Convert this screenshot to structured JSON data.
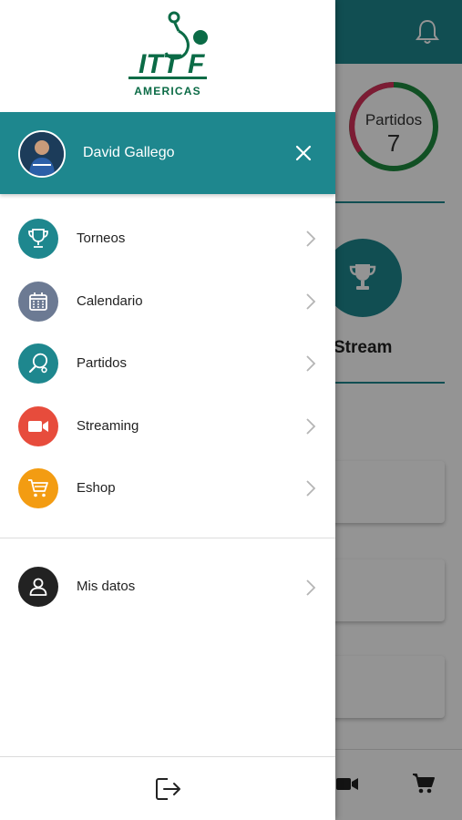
{
  "background": {
    "ring_label": "Partidos",
    "ring_value": "7",
    "stream_label": "Stream",
    "icons": [
      "bell-icon",
      "trophy-icon",
      "video-icon",
      "cart-icon"
    ],
    "colors": {
      "teal": "#1e878e",
      "ring_red": "#d6315b",
      "ring_green": "#1e8a3e"
    }
  },
  "drawer": {
    "logo": {
      "brand": "ITTF",
      "subtitle": "AMERICAS",
      "color": "#0b6b46"
    },
    "user": {
      "name": "David Gallego",
      "close_icon": "close-icon"
    },
    "menu": [
      {
        "label": "Torneos",
        "icon": "trophy-icon",
        "color": "#1e878e"
      },
      {
        "label": "Calendario",
        "icon": "calendar-icon",
        "color": "#6c7a93"
      },
      {
        "label": "Partidos",
        "icon": "paddle-icon",
        "color": "#1e878e"
      },
      {
        "label": "Streaming",
        "icon": "video-icon",
        "color": "#e74c3c"
      },
      {
        "label": "Eshop",
        "icon": "cart-icon",
        "color": "#f39c12"
      }
    ],
    "account": {
      "label": "Mis datos",
      "icon": "user-icon",
      "color": "#222222"
    },
    "logout_icon": "logout-icon"
  }
}
